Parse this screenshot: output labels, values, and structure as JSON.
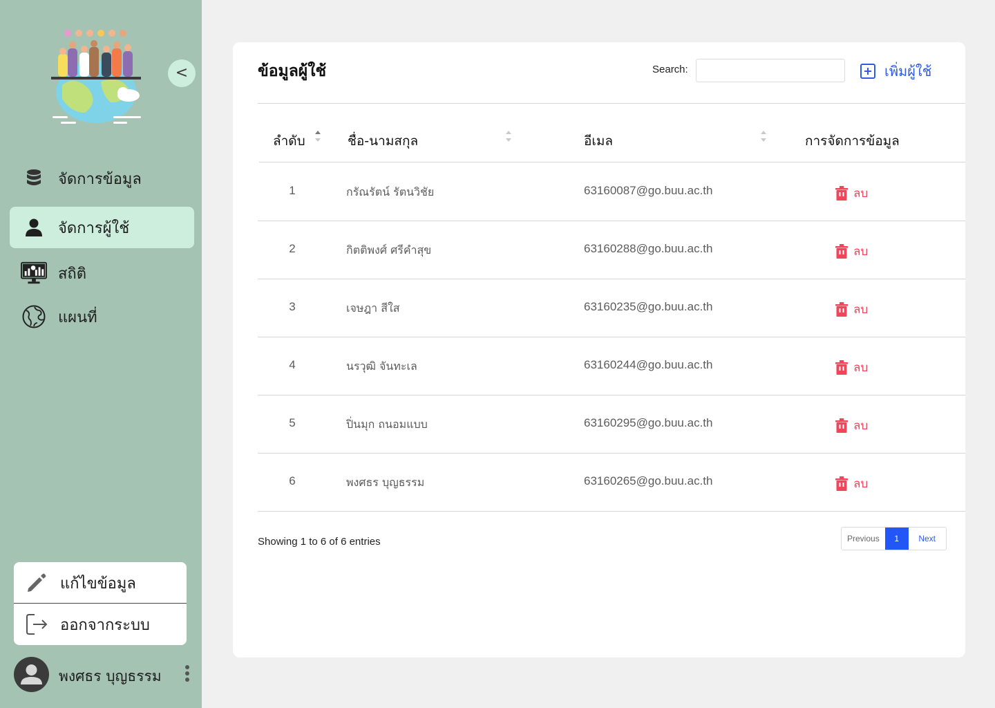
{
  "sidebar": {
    "collapse_glyph": "<",
    "nav": [
      {
        "label": "จัดการข้อมูล",
        "icon": "database-icon",
        "active": false
      },
      {
        "label": "จัดการผู้ใช้",
        "icon": "user-icon",
        "active": true
      },
      {
        "label": "สถิติ",
        "icon": "statistics-monitor-icon",
        "active": false
      },
      {
        "label": "แผนที่",
        "icon": "globe-icon",
        "active": false
      }
    ],
    "account_menu": [
      {
        "label": "แก้ไขข้อมูล",
        "icon": "pencil-icon"
      },
      {
        "label": "ออกจากระบบ",
        "icon": "logout-icon"
      }
    ],
    "profile": {
      "name": "พงศธร บุญธรรม",
      "icon": "avatar-icon"
    }
  },
  "main": {
    "title": "ข้อมูลผู้ใช้",
    "search": {
      "label": "Search:",
      "value": "",
      "placeholder": ""
    },
    "add_user": {
      "label": "เพิ่มผู้ใช้",
      "icon": "plus-square-icon"
    },
    "table": {
      "headers": [
        "ลำดับ",
        "ชื่อ-นามสกุล",
        "อีเมล",
        "การจัดการข้อมูล"
      ],
      "rows": [
        {
          "no": "1",
          "name": "กรัณรัตน์ รัตนวิชัย",
          "email": "63160087@go.buu.ac.th",
          "action": "ลบ"
        },
        {
          "no": "2",
          "name": "กิตติพงศ์ ศรีคำสุข",
          "email": "63160288@go.buu.ac.th",
          "action": "ลบ"
        },
        {
          "no": "3",
          "name": "เจษฎา สีใส",
          "email": "63160235@go.buu.ac.th",
          "action": "ลบ"
        },
        {
          "no": "4",
          "name": "นรวุฒิ จันทะเล",
          "email": "63160244@go.buu.ac.th",
          "action": "ลบ"
        },
        {
          "no": "5",
          "name": "ปิ่นมุก ถนอมแบบ",
          "email": "63160295@go.buu.ac.th",
          "action": "ลบ"
        },
        {
          "no": "6",
          "name": "พงศธร บุญธรรม",
          "email": "63160265@go.buu.ac.th",
          "action": "ลบ"
        }
      ]
    },
    "footer": {
      "info": "Showing 1 to 6 of 6 entries",
      "pagination": {
        "previous": "Previous",
        "current": "1",
        "next": "Next"
      }
    }
  },
  "colors": {
    "sidebar_bg": "#a4c3b2",
    "active_nav_bg": "#cdeedd",
    "accent_blue": "#2d5be3",
    "page_active_blue": "#2356f6",
    "delete_red": "#f0455b"
  }
}
